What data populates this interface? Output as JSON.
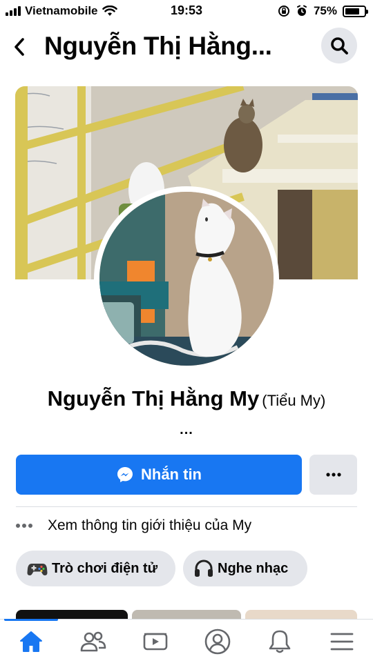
{
  "status_bar": {
    "carrier": "Vietnamobile",
    "time": "19:53",
    "battery_percent": "75%",
    "battery_level": 0.75
  },
  "header": {
    "title": "Nguyễn Thị Hằng...",
    "back_icon": "chevron-left-icon",
    "search_icon": "search-icon"
  },
  "profile": {
    "name": "Nguyễn Thị Hằng My",
    "alternate_name": "(Tiểu My)",
    "bio_more": "..."
  },
  "actions": {
    "message_label": "Nhắn tin",
    "message_icon": "messenger-icon",
    "more_label": "...",
    "accent_color": "#1877f2"
  },
  "intro": {
    "label": "Xem thông tin giới thiệu của My"
  },
  "hobbies": [
    {
      "label": "Trò chơi điện tử",
      "icon": "gamepad-icon"
    },
    {
      "label": "Nghe nhạc",
      "icon": "headphones-icon"
    }
  ],
  "bottom_nav": {
    "items": [
      "home-icon",
      "friends-icon",
      "watch-icon",
      "profile-icon",
      "notifications-icon",
      "menu-icon"
    ],
    "active": "home-icon"
  }
}
